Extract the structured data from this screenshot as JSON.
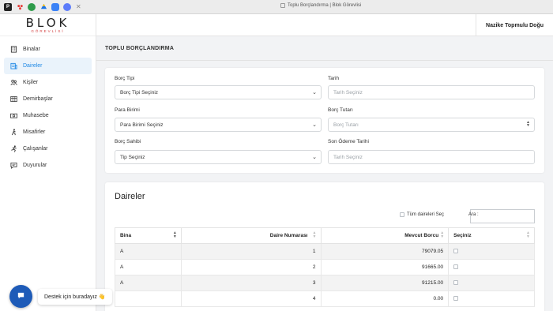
{
  "browser": {
    "tab_title": "Toplu Borçlandırma | Blok Görevlisi",
    "pinned_tabs": [
      {
        "icon": "p-app-icon",
        "label": "P",
        "color": "#222222"
      },
      {
        "icon": "people-icon",
        "label": "",
        "color": "#e53935"
      },
      {
        "icon": "green-app-icon",
        "label": "",
        "color": "#2e9b4a"
      },
      {
        "icon": "drive-icon",
        "label": "",
        "color": "#1a73e8"
      },
      {
        "icon": "chat-app-icon",
        "label": "",
        "color": "#3b82f6"
      },
      {
        "icon": "compass-icon",
        "label": "",
        "color": "#5c7cfa"
      }
    ]
  },
  "brand": {
    "name": "BLOK",
    "tagline": "GÖREVLİSİ",
    "accent_color": "#d23b3b"
  },
  "header": {
    "user_name": "Nazike Topmulu Doğu"
  },
  "sidebar": {
    "items": [
      {
        "label": "Binalar",
        "icon": "building-icon",
        "active": false
      },
      {
        "label": "Daireler",
        "icon": "apartment-icon",
        "active": true
      },
      {
        "label": "Kişiler",
        "icon": "people-icon",
        "active": false
      },
      {
        "label": "Demirbaşlar",
        "icon": "inventory-icon",
        "active": false
      },
      {
        "label": "Muhasebe",
        "icon": "money-icon",
        "active": false
      },
      {
        "label": "Misafirler",
        "icon": "walking-icon",
        "active": false
      },
      {
        "label": "Çalışanlar",
        "icon": "running-icon",
        "active": false
      },
      {
        "label": "Duyurular",
        "icon": "announcement-icon",
        "active": false
      }
    ],
    "active_color": "#1e88e5"
  },
  "page": {
    "title": "TOPLU BORÇLANDIRMA"
  },
  "form": {
    "borc_tipi": {
      "label": "Borç Tipi",
      "value": "Borç Tipi Seçiniz"
    },
    "tarih": {
      "label": "Tarih",
      "placeholder": "Tarih Seçiniz"
    },
    "para_birimi": {
      "label": "Para Birimi",
      "value": "Para Birimi Seçiniz"
    },
    "borc_tutari": {
      "label": "Borç Tutarı",
      "placeholder": "Borç Tutarı"
    },
    "borc_sahibi": {
      "label": "Borç Sahibi",
      "value": "Tip Seçiniz"
    },
    "son_odeme": {
      "label": "Son Ödeme Tarihi",
      "placeholder": "Tarih Seçiniz"
    }
  },
  "table_section": {
    "title": "Daireler",
    "select_all_label": "Tüm daireleri Seç",
    "search_label": "Ara :",
    "columns": [
      "Bina",
      "Daire Numarası",
      "Mevcut Borcu",
      "Seçiniz"
    ],
    "rows": [
      {
        "bina": "A",
        "daire": "1",
        "borc": "79079.05"
      },
      {
        "bina": "A",
        "daire": "2",
        "borc": "91665.00"
      },
      {
        "bina": "A",
        "daire": "3",
        "borc": "91215.00"
      },
      {
        "bina": "",
        "daire": "4",
        "borc": "0.00"
      }
    ]
  },
  "support": {
    "label": "Destek için buradayız 👋"
  }
}
